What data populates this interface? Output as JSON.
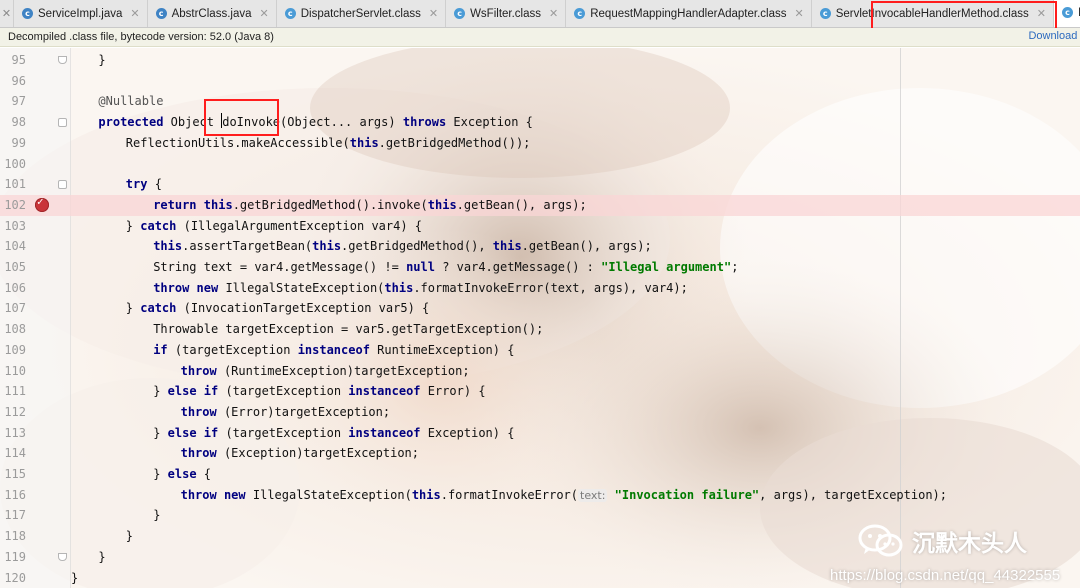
{
  "tabs": [
    {
      "label": "ServiceImpl.java",
      "icon": "java-class-icon"
    },
    {
      "label": "AbstrClass.java",
      "icon": "java-class-icon"
    },
    {
      "label": "DispatcherServlet.class",
      "icon": "class-file-icon"
    },
    {
      "label": "WsFilter.class",
      "icon": "class-file-icon"
    },
    {
      "label": "RequestMappingHandlerAdapter.class",
      "icon": "class-file-icon"
    },
    {
      "label": "ServletInvocableHandlerMethod.class",
      "icon": "class-file-icon"
    },
    {
      "label": "InvocableHandlerMethod.class",
      "icon": "class-file-icon",
      "active": true
    }
  ],
  "banner": {
    "text": "Decompiled .class file, bytecode version: 52.0 (Java 8)",
    "link": "Download Sou"
  },
  "editor": {
    "lines": [
      {
        "n": "95",
        "indent": 1,
        "tokens": [
          [
            "p",
            "}"
          ]
        ],
        "fold": "end"
      },
      {
        "n": "96",
        "indent": 0,
        "tokens": []
      },
      {
        "n": "97",
        "indent": 1,
        "tokens": [
          [
            "ann",
            "@Nullable"
          ]
        ]
      },
      {
        "n": "98",
        "indent": 1,
        "tokens": [
          [
            "kw",
            "protected"
          ],
          [
            "p",
            " Object "
          ],
          [
            "caret",
            ""
          ],
          [
            "p",
            "doInvoke(Object... args) "
          ],
          [
            "kw",
            "throws"
          ],
          [
            "p",
            " Exception {"
          ]
        ],
        "fold": "start"
      },
      {
        "n": "99",
        "indent": 2,
        "tokens": [
          [
            "p",
            "ReflectionUtils.makeAccessible("
          ],
          [
            "kw",
            "this"
          ],
          [
            "p",
            ".getBridgedMethod());"
          ]
        ]
      },
      {
        "n": "100",
        "indent": 0,
        "tokens": []
      },
      {
        "n": "101",
        "indent": 2,
        "tokens": [
          [
            "kw",
            "try"
          ],
          [
            "p",
            " {"
          ]
        ],
        "fold": "start"
      },
      {
        "n": "102",
        "indent": 3,
        "tokens": [
          [
            "kw",
            "return"
          ],
          [
            "p",
            " "
          ],
          [
            "kw",
            "this"
          ],
          [
            "p",
            ".getBridgedMethod().invoke("
          ],
          [
            "kw",
            "this"
          ],
          [
            "p",
            ".getBean(), args);"
          ]
        ],
        "breakpoint": true
      },
      {
        "n": "103",
        "indent": 2,
        "tokens": [
          [
            "p",
            "} "
          ],
          [
            "kw",
            "catch"
          ],
          [
            "p",
            " (IllegalArgumentException var4) {"
          ]
        ]
      },
      {
        "n": "104",
        "indent": 3,
        "tokens": [
          [
            "kw",
            "this"
          ],
          [
            "p",
            ".assertTargetBean("
          ],
          [
            "kw",
            "this"
          ],
          [
            "p",
            ".getBridgedMethod(), "
          ],
          [
            "kw",
            "this"
          ],
          [
            "p",
            ".getBean(), args);"
          ]
        ]
      },
      {
        "n": "105",
        "indent": 3,
        "tokens": [
          [
            "p",
            "String text = var4.getMessage() != "
          ],
          [
            "kw",
            "null"
          ],
          [
            "p",
            " ? var4.getMessage() : "
          ],
          [
            "str",
            "\"Illegal argument\""
          ],
          [
            "p",
            ";"
          ]
        ]
      },
      {
        "n": "106",
        "indent": 3,
        "tokens": [
          [
            "kw",
            "throw"
          ],
          [
            "p",
            " "
          ],
          [
            "kw",
            "new"
          ],
          [
            "p",
            " IllegalStateException("
          ],
          [
            "kw",
            "this"
          ],
          [
            "p",
            ".formatInvokeError(text, args), var4);"
          ]
        ]
      },
      {
        "n": "107",
        "indent": 2,
        "tokens": [
          [
            "p",
            "} "
          ],
          [
            "kw",
            "catch"
          ],
          [
            "p",
            " (InvocationTargetException var5) {"
          ]
        ]
      },
      {
        "n": "108",
        "indent": 3,
        "tokens": [
          [
            "p",
            "Throwable targetException = var5.getTargetException();"
          ]
        ]
      },
      {
        "n": "109",
        "indent": 3,
        "tokens": [
          [
            "kw",
            "if"
          ],
          [
            "p",
            " (targetException "
          ],
          [
            "kw",
            "instanceof"
          ],
          [
            "p",
            " RuntimeException) {"
          ]
        ]
      },
      {
        "n": "110",
        "indent": 4,
        "tokens": [
          [
            "kw",
            "throw"
          ],
          [
            "p",
            " (RuntimeException)targetException;"
          ]
        ]
      },
      {
        "n": "111",
        "indent": 3,
        "tokens": [
          [
            "p",
            "} "
          ],
          [
            "kw",
            "else if"
          ],
          [
            "p",
            " (targetException "
          ],
          [
            "kw",
            "instanceof"
          ],
          [
            "p",
            " Error) {"
          ]
        ]
      },
      {
        "n": "112",
        "indent": 4,
        "tokens": [
          [
            "kw",
            "throw"
          ],
          [
            "p",
            " (Error)targetException;"
          ]
        ]
      },
      {
        "n": "113",
        "indent": 3,
        "tokens": [
          [
            "p",
            "} "
          ],
          [
            "kw",
            "else if"
          ],
          [
            "p",
            " (targetException "
          ],
          [
            "kw",
            "instanceof"
          ],
          [
            "p",
            " Exception) {"
          ]
        ]
      },
      {
        "n": "114",
        "indent": 4,
        "tokens": [
          [
            "kw",
            "throw"
          ],
          [
            "p",
            " (Exception)targetException;"
          ]
        ]
      },
      {
        "n": "115",
        "indent": 3,
        "tokens": [
          [
            "p",
            "} "
          ],
          [
            "kw",
            "else"
          ],
          [
            "p",
            " {"
          ]
        ]
      },
      {
        "n": "116",
        "indent": 4,
        "tokens": [
          [
            "kw",
            "throw"
          ],
          [
            "p",
            " "
          ],
          [
            "kw",
            "new"
          ],
          [
            "p",
            " IllegalStateException("
          ],
          [
            "kw",
            "this"
          ],
          [
            "p",
            ".formatInvokeError("
          ],
          [
            "hint",
            "text:"
          ],
          [
            "p",
            " "
          ],
          [
            "str",
            "\"Invocation failure\""
          ],
          [
            "p",
            ", args), targetException);"
          ]
        ]
      },
      {
        "n": "117",
        "indent": 3,
        "tokens": [
          [
            "p",
            "}"
          ]
        ]
      },
      {
        "n": "118",
        "indent": 2,
        "tokens": [
          [
            "p",
            "}"
          ]
        ]
      },
      {
        "n": "119",
        "indent": 1,
        "tokens": [
          [
            "p",
            "}"
          ]
        ],
        "fold": "end"
      },
      {
        "n": "120",
        "indent": 0,
        "tokens": [
          [
            "p",
            "}"
          ]
        ]
      }
    ]
  },
  "watermark": {
    "name": "沉默木头人",
    "url": "https://blog.csdn.net/qq_44322555",
    "icon": "wechat-icon"
  },
  "colors": {
    "keyword": "#000080",
    "string": "#007a00",
    "highlight_box": "#ff1d1d",
    "breakpoint": "#c9353a"
  }
}
